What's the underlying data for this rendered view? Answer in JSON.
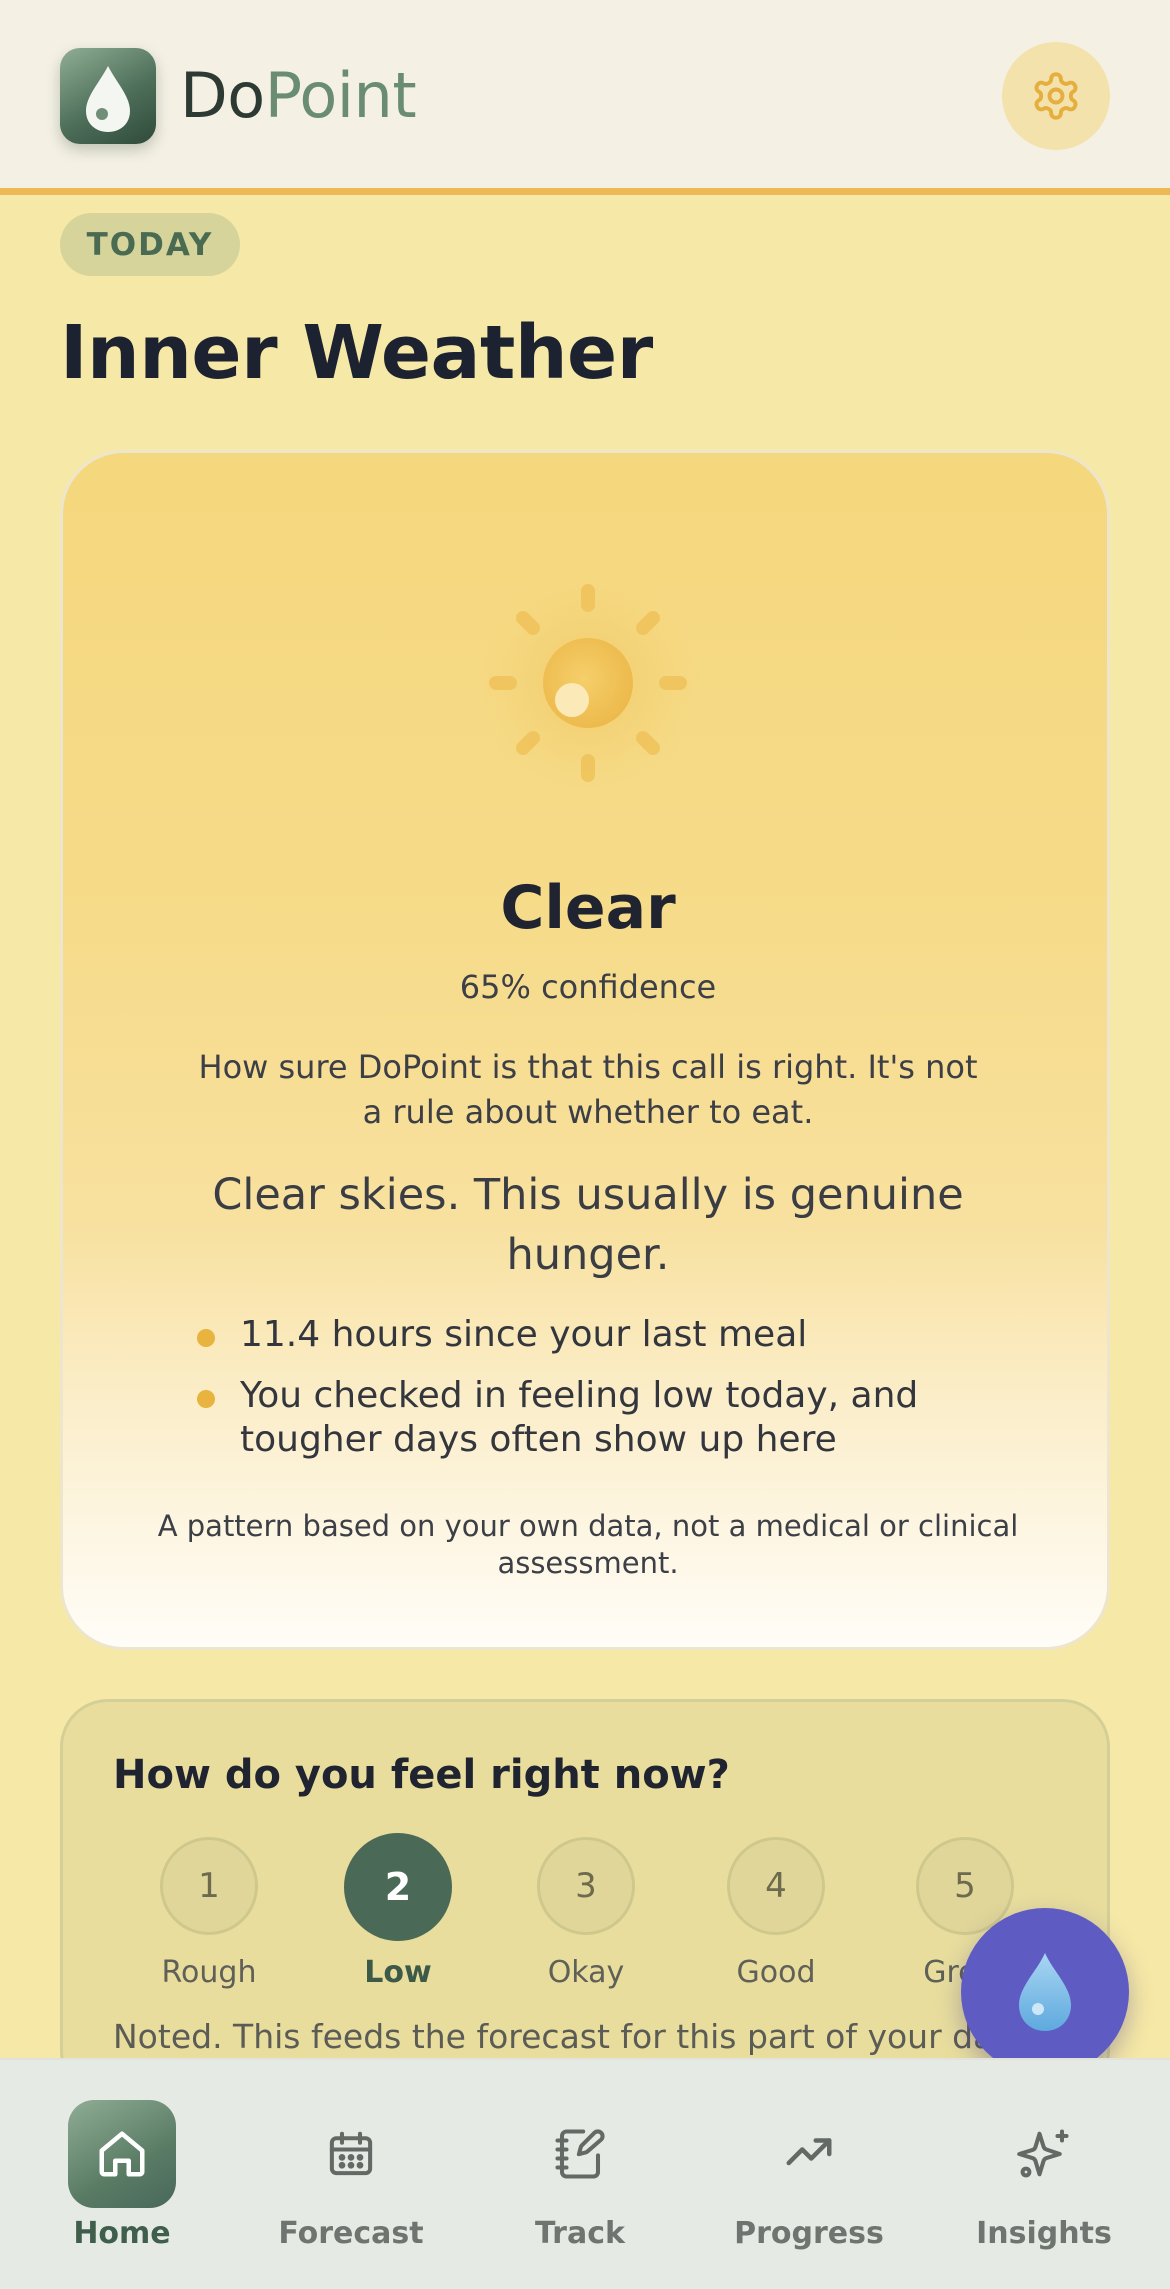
{
  "header": {
    "brand_part1": "Do",
    "brand_part2": "Point",
    "logo_icon": "droplet-icon",
    "settings_icon": "gear-icon"
  },
  "section": {
    "badge": "TODAY",
    "title": "Inner Weather"
  },
  "weather": {
    "icon": "sun-icon",
    "label": "Clear",
    "confidence": "65% confidence",
    "confidence_note": "How sure DoPoint is that this call is right. It's not a rule about whether to eat.",
    "summary": "Clear skies. This usually is genuine hunger.",
    "reasons": [
      "11.4 hours since your last meal",
      "You checked in feeling low today, and tougher days often show up here"
    ],
    "disclaimer": "A pattern based on your own data, not a medical or clinical assessment."
  },
  "mood": {
    "question": "How do you feel right now?",
    "options": [
      {
        "value": "1",
        "label": "Rough"
      },
      {
        "value": "2",
        "label": "Low"
      },
      {
        "value": "3",
        "label": "Okay"
      },
      {
        "value": "4",
        "label": "Good"
      },
      {
        "value": "5",
        "label": "Great"
      }
    ],
    "selected_value": "2",
    "feedback": "Noted. This feeds the forecast for this part of your day."
  },
  "fab": {
    "icon": "droplet-icon"
  },
  "nav": {
    "items": [
      {
        "label": "Home",
        "icon": "home-icon"
      },
      {
        "label": "Forecast",
        "icon": "calendar-icon"
      },
      {
        "label": "Track",
        "icon": "notebook-pen-icon"
      },
      {
        "label": "Progress",
        "icon": "trend-up-icon"
      },
      {
        "label": "Insights",
        "icon": "sparkles-icon"
      }
    ],
    "active": "Home"
  },
  "colors": {
    "background": "#f6e8a6",
    "accent_green": "#4a6a57",
    "accent_gold": "#ecb954",
    "fab": "#5e5bc2"
  }
}
